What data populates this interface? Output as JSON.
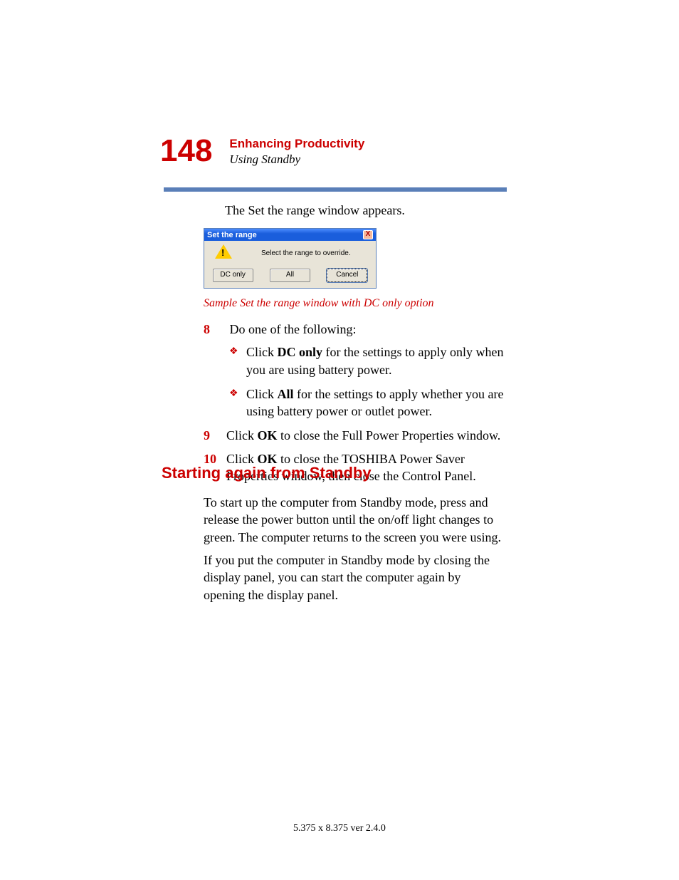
{
  "header": {
    "page_number": "148",
    "chapter_title": "Enhancing Productivity",
    "chapter_subtitle": "Using Standby"
  },
  "intro_line": "The Set the range window appears.",
  "dialog": {
    "title": "Set the range",
    "message": "Select the range to override.",
    "buttons": {
      "dc_only": "DC only",
      "all": "All",
      "cancel": "Cancel"
    }
  },
  "caption": "Sample Set the range window with DC only option",
  "steps": {
    "step8_num": "8",
    "step8_text": "Do one of the following:",
    "bullet1_pre": "Click ",
    "bullet1_bold": "DC only",
    "bullet1_post": " for the settings to apply only when you are using battery power.",
    "bullet2_pre": "Click ",
    "bullet2_bold": "All",
    "bullet2_post": " for the settings to apply whether you are using battery power or outlet power.",
    "step9_num": "9",
    "step9_pre": "Click ",
    "step9_bold": "OK",
    "step9_post": " to close the Full Power Properties window.",
    "step10_num": "10",
    "step10_pre": "Click ",
    "step10_bold": "OK",
    "step10_post": " to close the TOSHIBA Power Saver Properties window, then close the Control Panel."
  },
  "section_heading": "Starting again from Standby",
  "paragraphs": {
    "p1": "To start up the computer from Standby mode, press and release the power button until the on/off light changes to green. The computer returns to the screen you were using.",
    "p2": "If you put the computer in Standby mode by closing the display panel, you can start the computer again by opening the display panel."
  },
  "footer": "5.375 x 8.375 ver 2.4.0"
}
